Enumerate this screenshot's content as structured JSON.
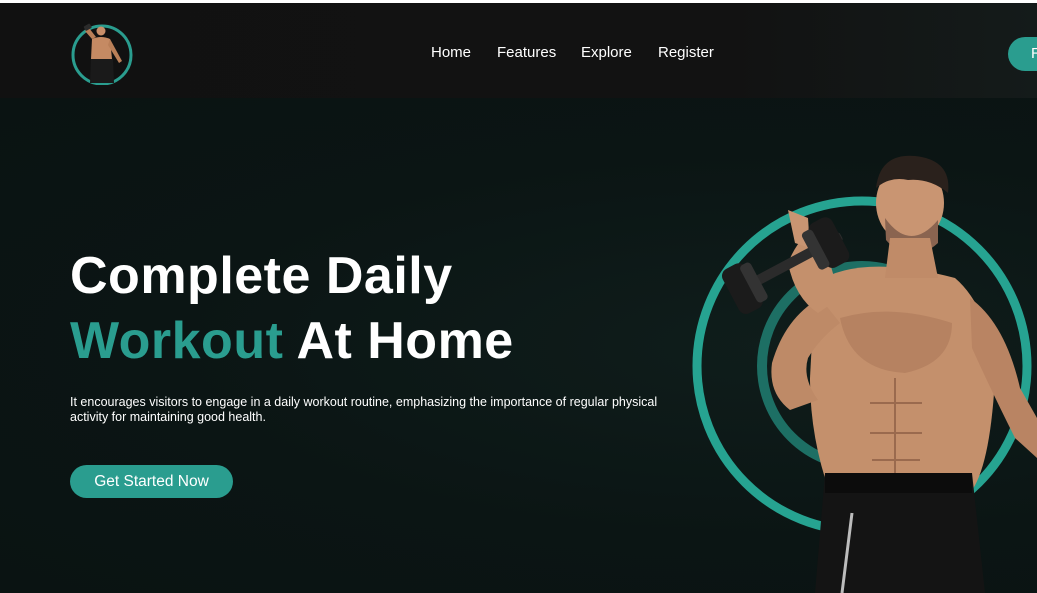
{
  "navbar": {
    "links": [
      "Home",
      "Features",
      "Explore",
      "Register"
    ],
    "cta_label": "R"
  },
  "hero": {
    "title_line1": "Complete Daily",
    "title_accent": "Workout",
    "title_rest": "At Home",
    "description": "It encourages visitors to engage in a daily workout routine, emphasizing the importance of regular physical activity for maintaining good health.",
    "cta_label": "Get Started Now"
  },
  "colors": {
    "accent": "#2a9d8f",
    "background": "#0b1514",
    "navbar": "#121212",
    "text": "#ffffff"
  },
  "icons": {
    "logo": "athlete-logo",
    "hero_image": "man-with-dumbbell"
  }
}
